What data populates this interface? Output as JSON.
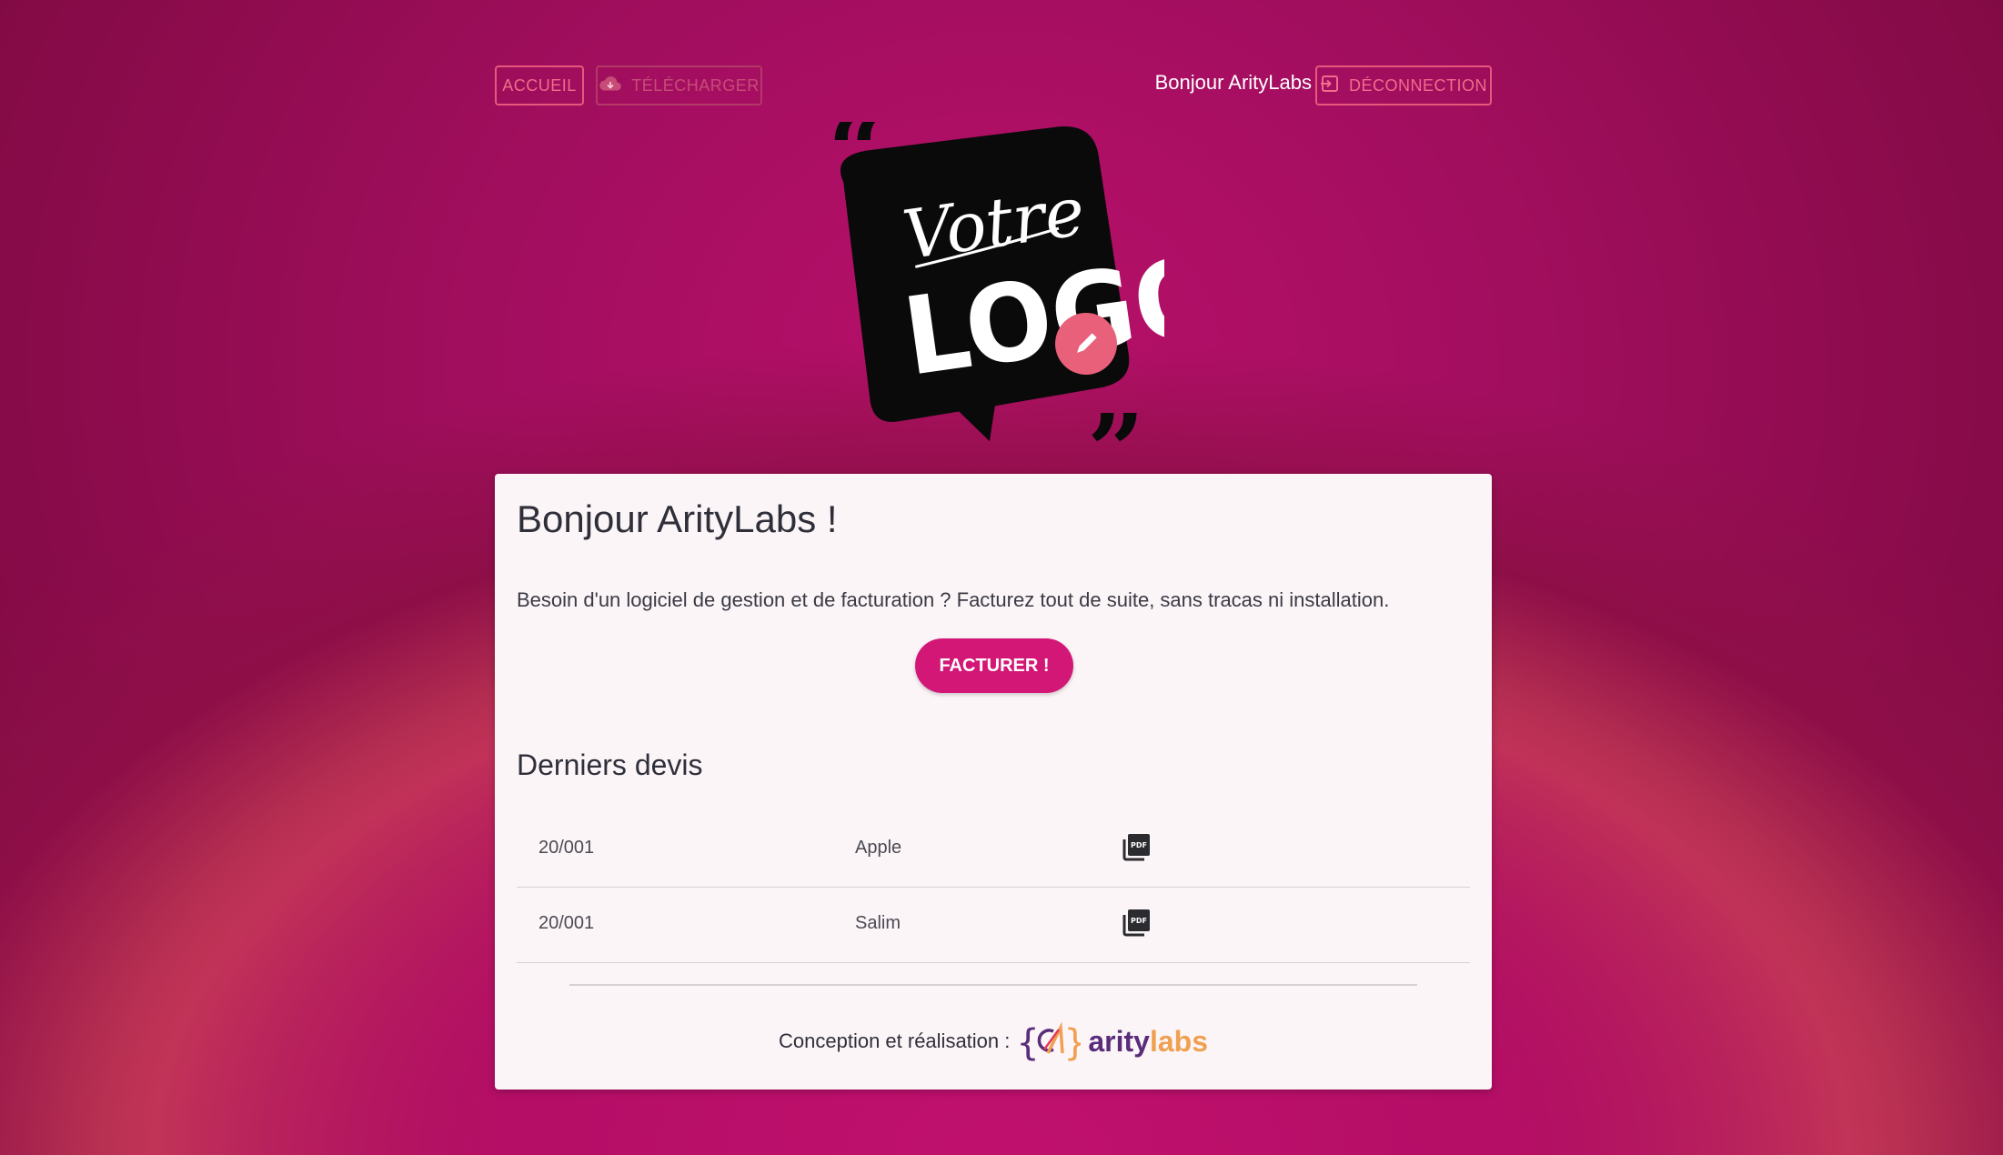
{
  "nav": {
    "home_label": "ACCUEIL",
    "download_label": "TÉLÉCHARGER",
    "greeting": "Bonjour ArityLabs",
    "logout_label": "DÉCONNECTION"
  },
  "logo": {
    "line1": "Votre",
    "line2": "LOGO"
  },
  "card": {
    "title": "Bonjour ArityLabs !",
    "intro": "Besoin d'un logiciel de gestion et de facturation ? Facturez tout de suite, sans tracas ni installation.",
    "cta_label": "FACTURER !",
    "quotes_heading": "Derniers devis",
    "quotes": [
      {
        "number": "20/001",
        "client": "Apple",
        "pdf_icon": "pdf-icon"
      },
      {
        "number": "20/001",
        "client": "Salim",
        "pdf_icon": "pdf-icon"
      }
    ],
    "footer_label": "Conception et réalisation :",
    "brand_main": "arity",
    "brand_accent": "labs"
  },
  "colors": {
    "accent": "#d31777",
    "outline": "#e8587c",
    "brand_purple": "#5a2d7a",
    "brand_orange": "#f0a050"
  }
}
